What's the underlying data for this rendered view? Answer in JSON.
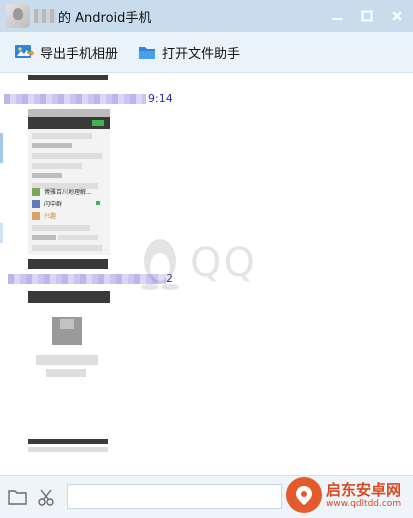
{
  "window": {
    "title": "的 Android手机"
  },
  "toolbar": {
    "export_album_label": "导出手机相册",
    "open_file_helper_label": "打开文件助手"
  },
  "chat": {
    "timestamp_1": "9:14",
    "timestamp_2": "2",
    "screenshot_apps": [
      {
        "label": "博雅百川地理解..."
      },
      {
        "label": "闪中群"
      },
      {
        "label": "兴趣"
      }
    ]
  },
  "watermark": {
    "text": "QQ"
  },
  "input": {
    "value": ""
  },
  "brand": {
    "name": "启东安卓网",
    "url": "www.qdltdd.com"
  },
  "colors": {
    "titlebar": "#c9dcee",
    "toolbar": "#eaf2fa",
    "accent_blue": "#2f86d6",
    "brand_orange": "#e45a2b"
  }
}
